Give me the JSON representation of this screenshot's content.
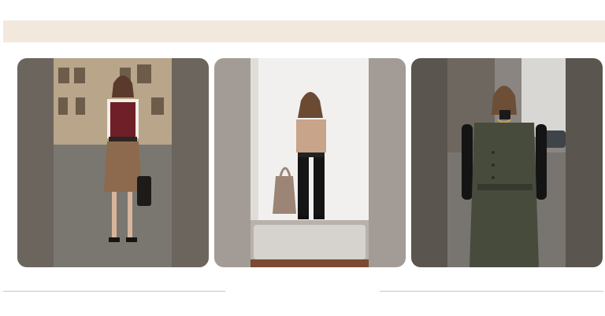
{
  "header": {
    "band_color": "#f2e8de"
  },
  "gallery": {
    "cards": [
      {
        "subject": "woman-in-burgundy-vest-and-brown-skirt",
        "frame_color": "#6b655d",
        "icon": "photo-icon"
      },
      {
        "subject": "woman-in-satin-blouse-and-black-trousers",
        "frame_color": "#a39c96",
        "icon": "photo-icon"
      },
      {
        "subject": "woman-in-olive-vest-dress-and-black-turtleneck",
        "frame_color": "#5b554f",
        "icon": "photo-icon"
      }
    ]
  },
  "footer": {
    "divider_color": "#c7c7c7"
  }
}
